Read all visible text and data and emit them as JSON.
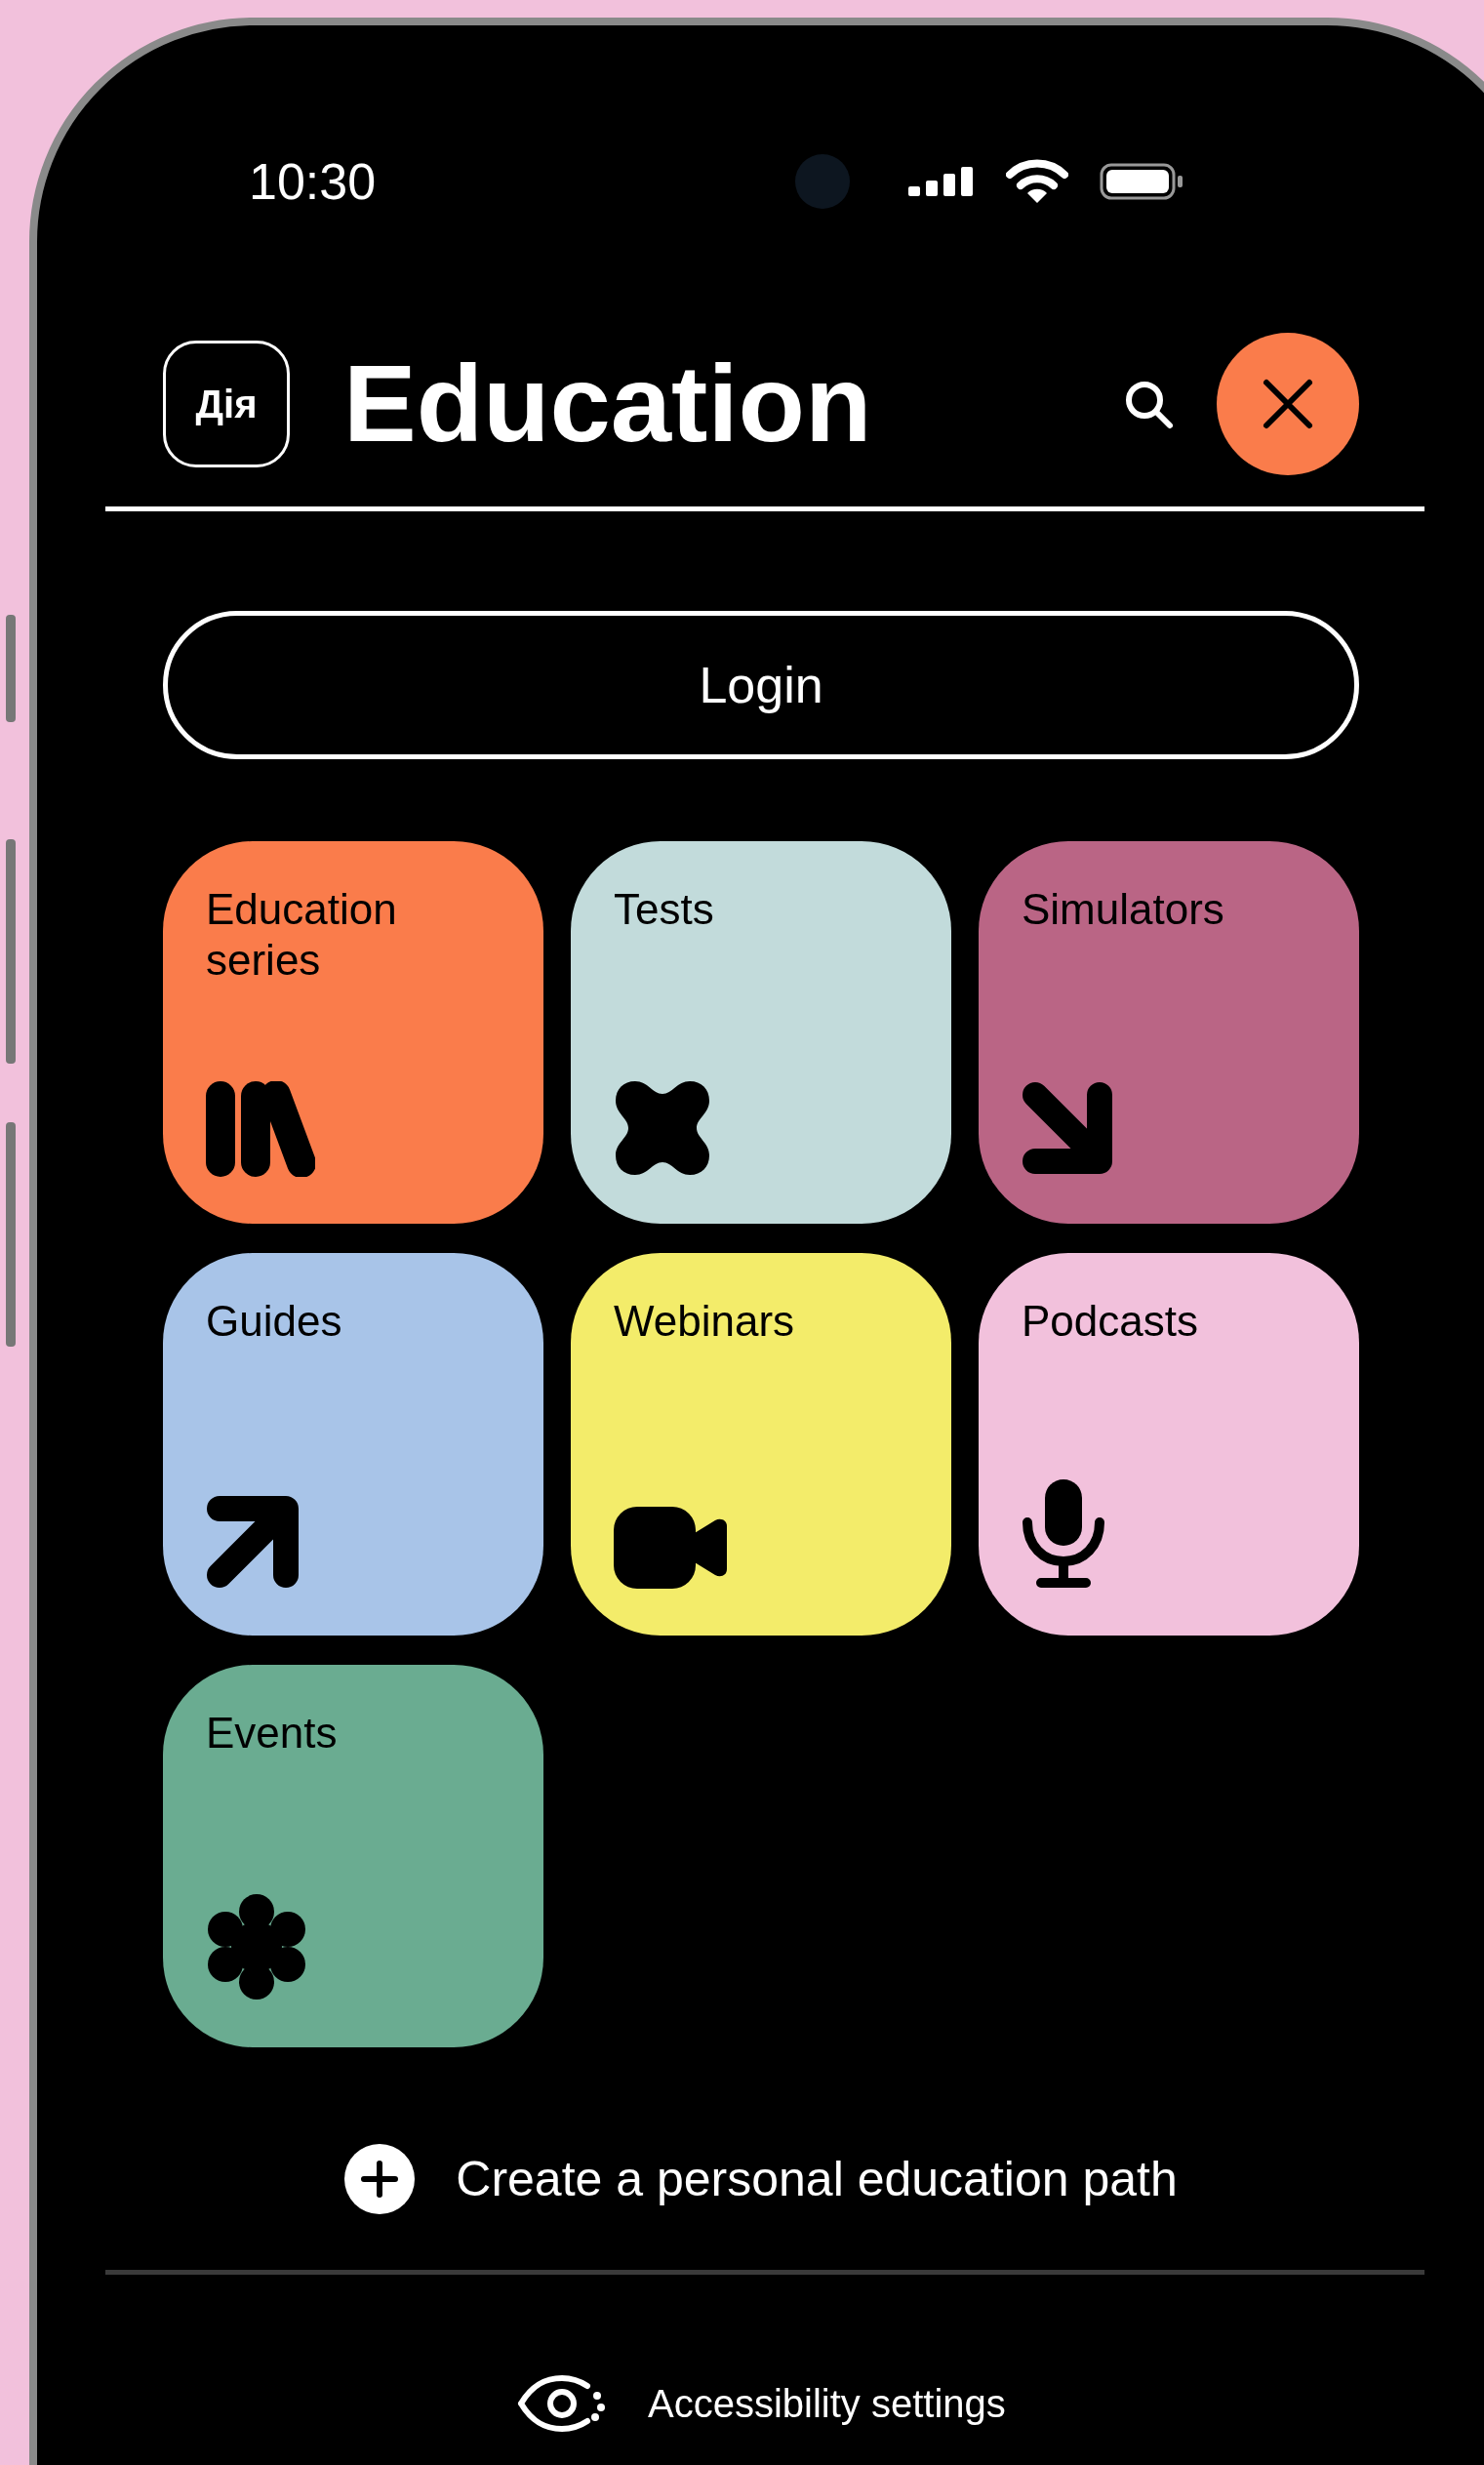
{
  "status_bar": {
    "time": "10:30"
  },
  "header": {
    "logo": "Дія",
    "title": "Education"
  },
  "login_button": "Login",
  "tiles": [
    {
      "label": "Education series",
      "color": "#fa7c4b",
      "kind": "books"
    },
    {
      "label": "Tests",
      "color": "#c2dbdb",
      "kind": "cross"
    },
    {
      "label": "Simulators",
      "color": "#ba6585",
      "kind": "arrow-down-right"
    },
    {
      "label": "Guides",
      "color": "#a8c4e8",
      "kind": "arrow-up-right"
    },
    {
      "label": "Webinars",
      "color": "#f3ec6a",
      "kind": "camera"
    },
    {
      "label": "Podcasts",
      "color": "#f2c1dc",
      "kind": "microphone"
    },
    {
      "label": "Events",
      "color": "#6aac91",
      "kind": "flower"
    }
  ],
  "create_path": "Create a personal education path",
  "accessibility": "Accessibility settings"
}
